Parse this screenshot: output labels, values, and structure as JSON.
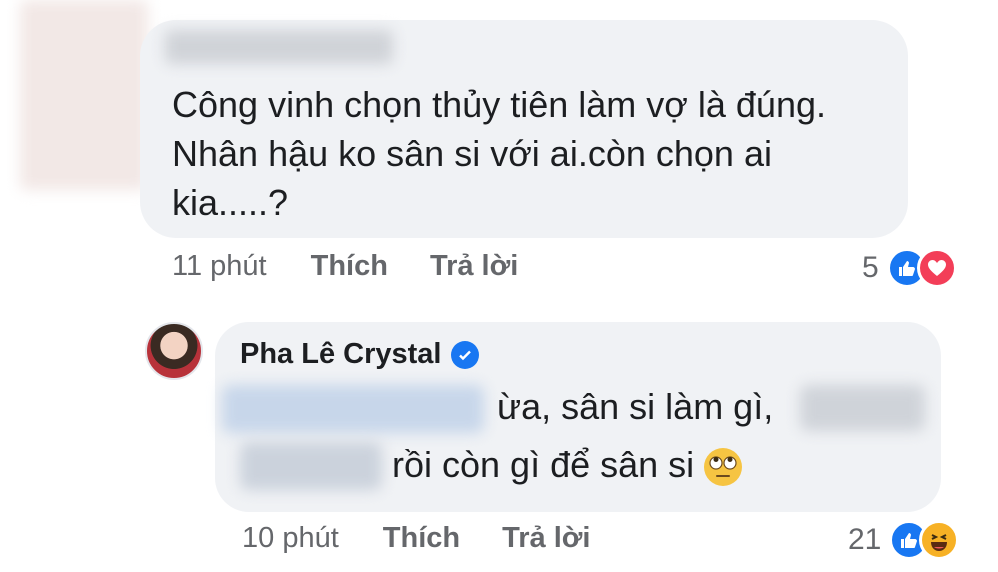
{
  "comment1": {
    "author_hidden": true,
    "text_lines": [
      "Công vinh chọn thủy tiên làm vợ là đúng.",
      "Nhân hậu ko sân si với ai.còn chọn ai",
      "kia.....?"
    ],
    "time": "11 phút",
    "like_label": "Thích",
    "reply_label": "Trả lời",
    "reaction_count": "5",
    "reactions": [
      "like-icon",
      "love-icon"
    ]
  },
  "comment2": {
    "author": "Pha Lê Crystal",
    "verified": true,
    "line1_visible": "ừa, sân si làm gì,",
    "line2_visible": "rồi còn gì để sân si",
    "emoji": "face-with-rolling-eyes-icon",
    "time": "10 phút",
    "like_label": "Thích",
    "reply_label": "Trả lời",
    "reaction_count": "21",
    "reactions": [
      "like-icon",
      "haha-icon"
    ]
  },
  "colors": {
    "bubble": "#f0f2f5",
    "meta_text": "#65676b",
    "like_blue": "#1877f2",
    "love_red": "#f33e58",
    "haha_yellow": "#f7b125"
  }
}
